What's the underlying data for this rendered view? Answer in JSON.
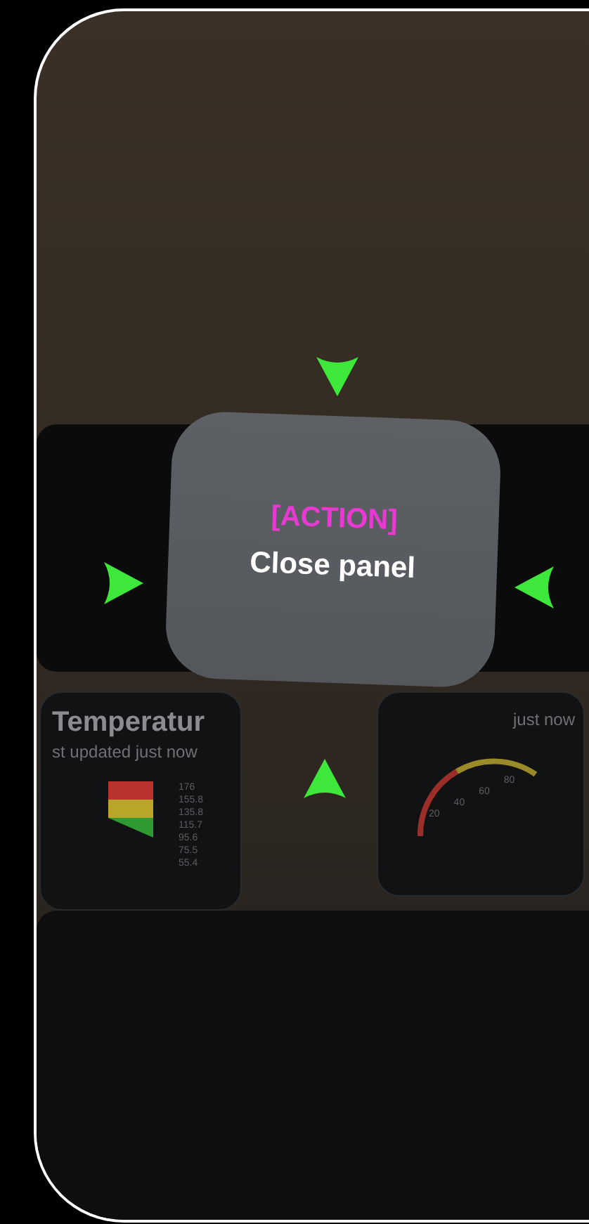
{
  "overlay": {
    "tag": "[ACTION]",
    "label": "Close panel"
  },
  "cards": [
    {
      "kind": "legend",
      "title": "Temperatur",
      "subtitle": "st updated just now",
      "values": [
        "176",
        "155.8",
        "135.8",
        "115.7",
        "95.6",
        "75.5",
        "55.4"
      ]
    },
    {
      "kind": "gauge",
      "subtitle": "just now",
      "values": [
        "20",
        "40",
        "60",
        "80"
      ]
    }
  ]
}
